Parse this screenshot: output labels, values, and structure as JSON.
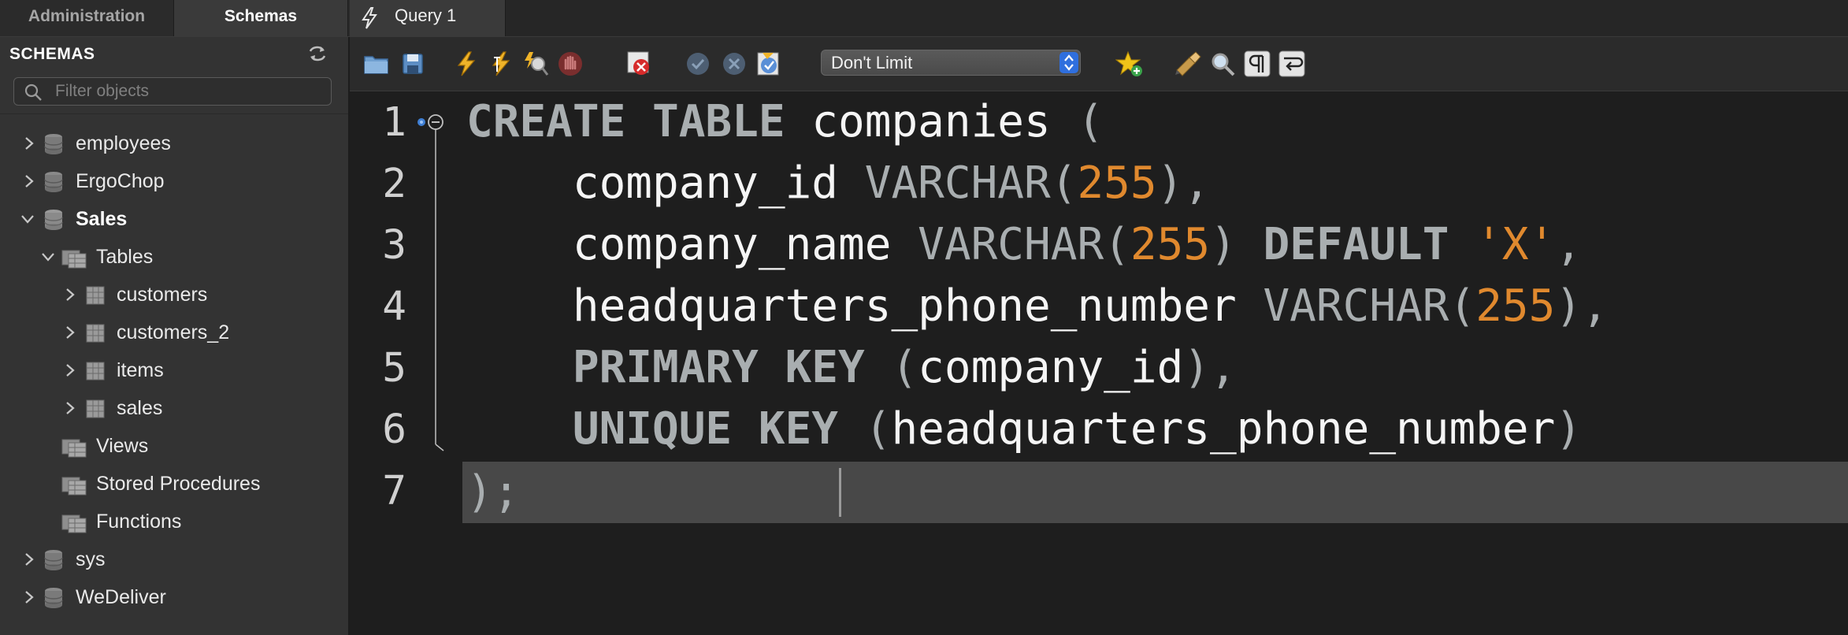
{
  "tabs": {
    "administration": "Administration",
    "schemas": "Schemas",
    "query": "Query 1"
  },
  "sidebar": {
    "title": "SCHEMAS",
    "filter_placeholder": "Filter objects",
    "tree": [
      {
        "label": "employees",
        "type": "schema",
        "expanded": false
      },
      {
        "label": "ErgoChop",
        "type": "schema",
        "expanded": false
      },
      {
        "label": "Sales",
        "type": "schema",
        "expanded": true,
        "selected": true
      },
      {
        "label": "Tables",
        "type": "folder",
        "expanded": true
      },
      {
        "label": "customers",
        "type": "table"
      },
      {
        "label": "customers_2",
        "type": "table"
      },
      {
        "label": "items",
        "type": "table"
      },
      {
        "label": "sales",
        "type": "table"
      },
      {
        "label": "Views",
        "type": "folder"
      },
      {
        "label": "Stored Procedures",
        "type": "folder"
      },
      {
        "label": "Functions",
        "type": "folder"
      },
      {
        "label": "sys",
        "type": "schema",
        "expanded": false
      },
      {
        "label": "WeDeliver",
        "type": "schema",
        "expanded": false
      }
    ]
  },
  "toolbar": {
    "limit_value": "Don't Limit",
    "icons": [
      "open-file-icon",
      "save-icon",
      "execute-icon",
      "execute-current-icon",
      "explain-icon",
      "stop-icon",
      "toggle-error-icon",
      "commit-icon",
      "rollback-icon",
      "autocommit-icon",
      "add-snippet-icon",
      "beautify-icon",
      "find-icon",
      "invisible-chars-icon",
      "wrap-lines-icon"
    ]
  },
  "editor": {
    "line_numbers": [
      "1",
      "2",
      "3",
      "4",
      "5",
      "6",
      "7"
    ],
    "lines": [
      [
        {
          "t": "CREATE TABLE",
          "c": "kw"
        },
        {
          "t": " companies ",
          "c": "id"
        },
        {
          "t": "(",
          "c": "pn"
        }
      ],
      [
        {
          "t": "    company_id ",
          "c": "id"
        },
        {
          "t": "VARCHAR",
          "c": "ty"
        },
        {
          "t": "(",
          "c": "pn"
        },
        {
          "t": "255",
          "c": "num"
        },
        {
          "t": "),",
          "c": "pn"
        }
      ],
      [
        {
          "t": "    company_name ",
          "c": "id"
        },
        {
          "t": "VARCHAR",
          "c": "ty"
        },
        {
          "t": "(",
          "c": "pn"
        },
        {
          "t": "255",
          "c": "num"
        },
        {
          "t": ") ",
          "c": "pn"
        },
        {
          "t": "DEFAULT",
          "c": "kw"
        },
        {
          "t": " ",
          "c": "id"
        },
        {
          "t": "'X'",
          "c": "str"
        },
        {
          "t": ",",
          "c": "pn"
        }
      ],
      [
        {
          "t": "    headquarters_phone_number ",
          "c": "id"
        },
        {
          "t": "VARCHAR",
          "c": "ty"
        },
        {
          "t": "(",
          "c": "pn"
        },
        {
          "t": "255",
          "c": "num"
        },
        {
          "t": "),",
          "c": "pn"
        }
      ],
      [
        {
          "t": "    ",
          "c": "id"
        },
        {
          "t": "PRIMARY KEY",
          "c": "kw"
        },
        {
          "t": " (",
          "c": "pn"
        },
        {
          "t": "company_id",
          "c": "id"
        },
        {
          "t": "),",
          "c": "pn"
        }
      ],
      [
        {
          "t": "    ",
          "c": "id"
        },
        {
          "t": "UNIQUE KEY",
          "c": "kw"
        },
        {
          "t": " (",
          "c": "pn"
        },
        {
          "t": "headquarters_phone_number",
          "c": "id"
        },
        {
          "t": ")",
          "c": "pn"
        }
      ],
      [
        {
          "t": ");",
          "c": "pn"
        }
      ]
    ]
  },
  "colors": {
    "keyword": "#a9aeb0",
    "number": "#e0892e",
    "string": "#e0892e",
    "identifier": "#f5f5f5",
    "current_line": "#484848"
  }
}
